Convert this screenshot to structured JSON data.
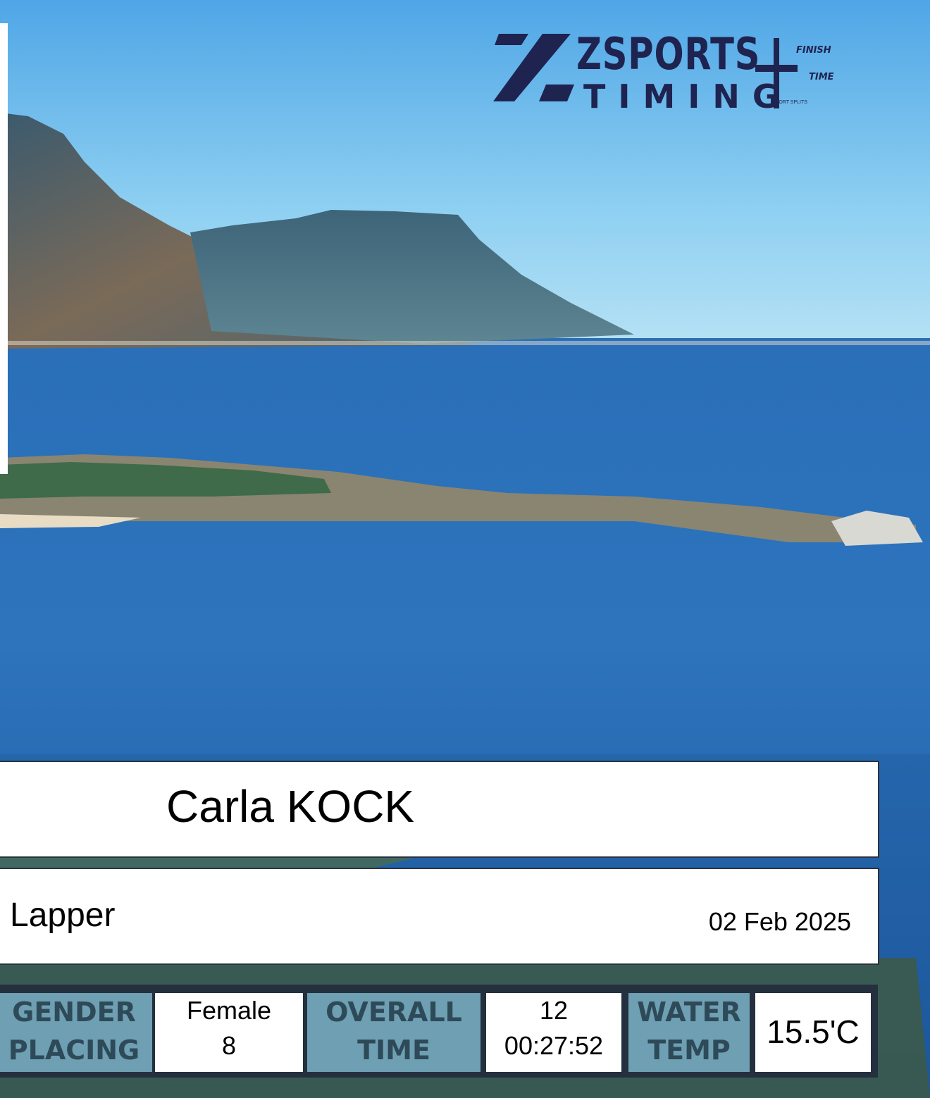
{
  "logo": {
    "line1": "ZSPORTS",
    "line2": "TIMING",
    "partner_top": "FINISH",
    "partner_bottom": "TIME",
    "partner_tag": "SPORT SPLITS"
  },
  "athlete": {
    "name": "Carla KOCK"
  },
  "event": {
    "name": "Lapper",
    "date": "02 Feb 2025"
  },
  "stats": {
    "gender_label_1": "GENDER",
    "gender_label_2": "PLACING",
    "gender_value_1": "Female",
    "gender_value_2": "8",
    "overall_label_1": "OVERALL",
    "overall_label_2": "TIME",
    "overall_value_1": "12",
    "overall_value_2": "00:27:52",
    "water_label_1": "WATER",
    "water_label_2": "TEMP",
    "water_value": "15.5'C"
  },
  "colors": {
    "sky": "#7fc4ee",
    "sea": "#1f5fae",
    "label_bg": "#6e9fb3",
    "logo": "#1f2350"
  }
}
